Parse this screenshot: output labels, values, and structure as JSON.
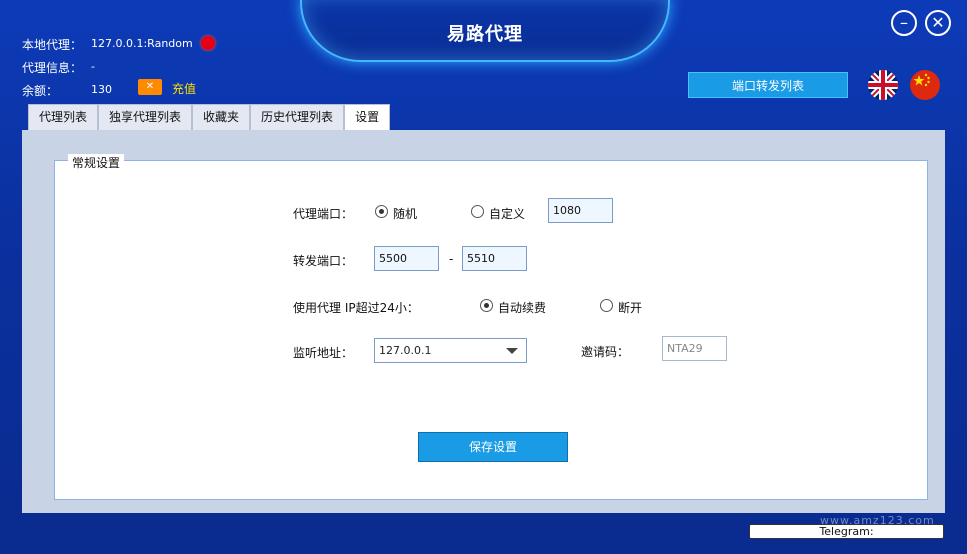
{
  "window": {
    "title": "易路代理",
    "minimize_label": "–",
    "close_label": "✕"
  },
  "info": {
    "local_proxy_label": "本地代理：",
    "local_proxy_value": "127.0.0.1:Random",
    "proxy_info_label": "代理信息：",
    "proxy_info_value": "-",
    "balance_label": "余额：",
    "balance_value": "130",
    "recharge_label": "充值",
    "recharge_icon": "ticket-icon",
    "status_color": "#e60012"
  },
  "header": {
    "port_forward_list_label": "端口转发列表",
    "english_flag": "uk-flag-icon",
    "chinese_flag": "china-flag-icon"
  },
  "tabs": [
    {
      "label": "代理列表",
      "active": false
    },
    {
      "label": "独享代理列表",
      "active": false
    },
    {
      "label": "收藏夹",
      "active": false
    },
    {
      "label": "历史代理列表",
      "active": false
    },
    {
      "label": "设置",
      "active": true
    }
  ],
  "settings": {
    "group_title": "常规设置",
    "proxy_port_label": "代理端口：",
    "random_label": "随机",
    "custom_label": "自定义",
    "custom_port_value": "1080",
    "proxy_port_mode": "random",
    "forward_port_label": "转发端口：",
    "forward_port_from": "5500",
    "forward_port_separator": "-",
    "forward_port_to": "5510",
    "ip_over_24h_label": "使用代理 IP超过24小：",
    "auto_renew_label": "自动续费",
    "disconnect_label": "断开",
    "ip_over_24h_mode": "auto_renew",
    "listen_address_label": "监听地址：",
    "listen_address_value": "127.0.0.1",
    "invite_code_label": "邀请码：",
    "invite_code_value": "NTA29",
    "save_label": "保存设置"
  },
  "footer": {
    "telegram_label": "Telegram:",
    "watermark": "www.amz123.com"
  },
  "colors": {
    "background": "#0b31a0",
    "accent": "#1a9be6",
    "glow": "#45b7ff",
    "recharge": "#ffe000"
  }
}
